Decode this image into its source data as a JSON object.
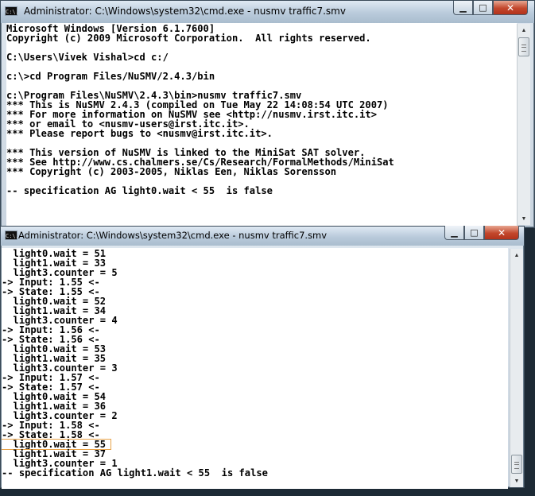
{
  "window1": {
    "title": "Administrator: C:\\Windows\\system32\\cmd.exe - nusmv  traffic7.smv",
    "icon_text": "C:\\.",
    "lines": [
      "Microsoft Windows [Version 6.1.7600]",
      "Copyright (c) 2009 Microsoft Corporation.  All rights reserved.",
      "",
      "C:\\Users\\Vivek Vishal>cd c:/",
      "",
      "c:\\>cd Program Files/NuSMV/2.4.3/bin",
      "",
      "c:\\Program Files\\NuSMV\\2.4.3\\bin>nusmv traffic7.smv",
      "*** This is NuSMV 2.4.3 (compiled on Tue May 22 14:08:54 UTC 2007)",
      "*** For more information on NuSMV see <http://nusmv.irst.itc.it>",
      "*** or email to <nusmv-users@irst.itc.it>.",
      "*** Please report bugs to <nusmv@irst.itc.it>.",
      "",
      "*** This version of NuSMV is linked to the MiniSat SAT solver.",
      "*** See http://www.cs.chalmers.se/Cs/Research/FormalMethods/MiniSat",
      "*** Copyright (c) 2003-2005, Niklas Een, Niklas Sorensson",
      "",
      "-- specification AG light0.wait < 55  is false"
    ]
  },
  "window2": {
    "title": "Administrator: C:\\Windows\\system32\\cmd.exe - nusmv  traffic7.smv",
    "icon_text": "C:\\.",
    "lines": [
      "  light0.wait = 51",
      "  light1.wait = 33",
      "  light3.counter = 5",
      "-> Input: 1.55 <-",
      "-> State: 1.55 <-",
      "  light0.wait = 52",
      "  light1.wait = 34",
      "  light3.counter = 4",
      "-> Input: 1.56 <-",
      "-> State: 1.56 <-",
      "  light0.wait = 53",
      "  light1.wait = 35",
      "  light3.counter = 3",
      "-> Input: 1.57 <-",
      "-> State: 1.57 <-",
      "  light0.wait = 54",
      "  light1.wait = 36",
      "  light3.counter = 2",
      "-> Input: 1.58 <-",
      "-> State: 1.58 <-",
      "  light0.wait = 55",
      "  light1.wait = 37",
      "  light3.counter = 1",
      "-- specification AG light1.wait < 55  is false"
    ],
    "highlighted_line_index": 20,
    "highlight_color": "#e8a34a"
  },
  "controls": {
    "minimize_icon": "minimize-icon",
    "maximize_icon": "maximize-icon",
    "close_icon": "close-icon"
  }
}
